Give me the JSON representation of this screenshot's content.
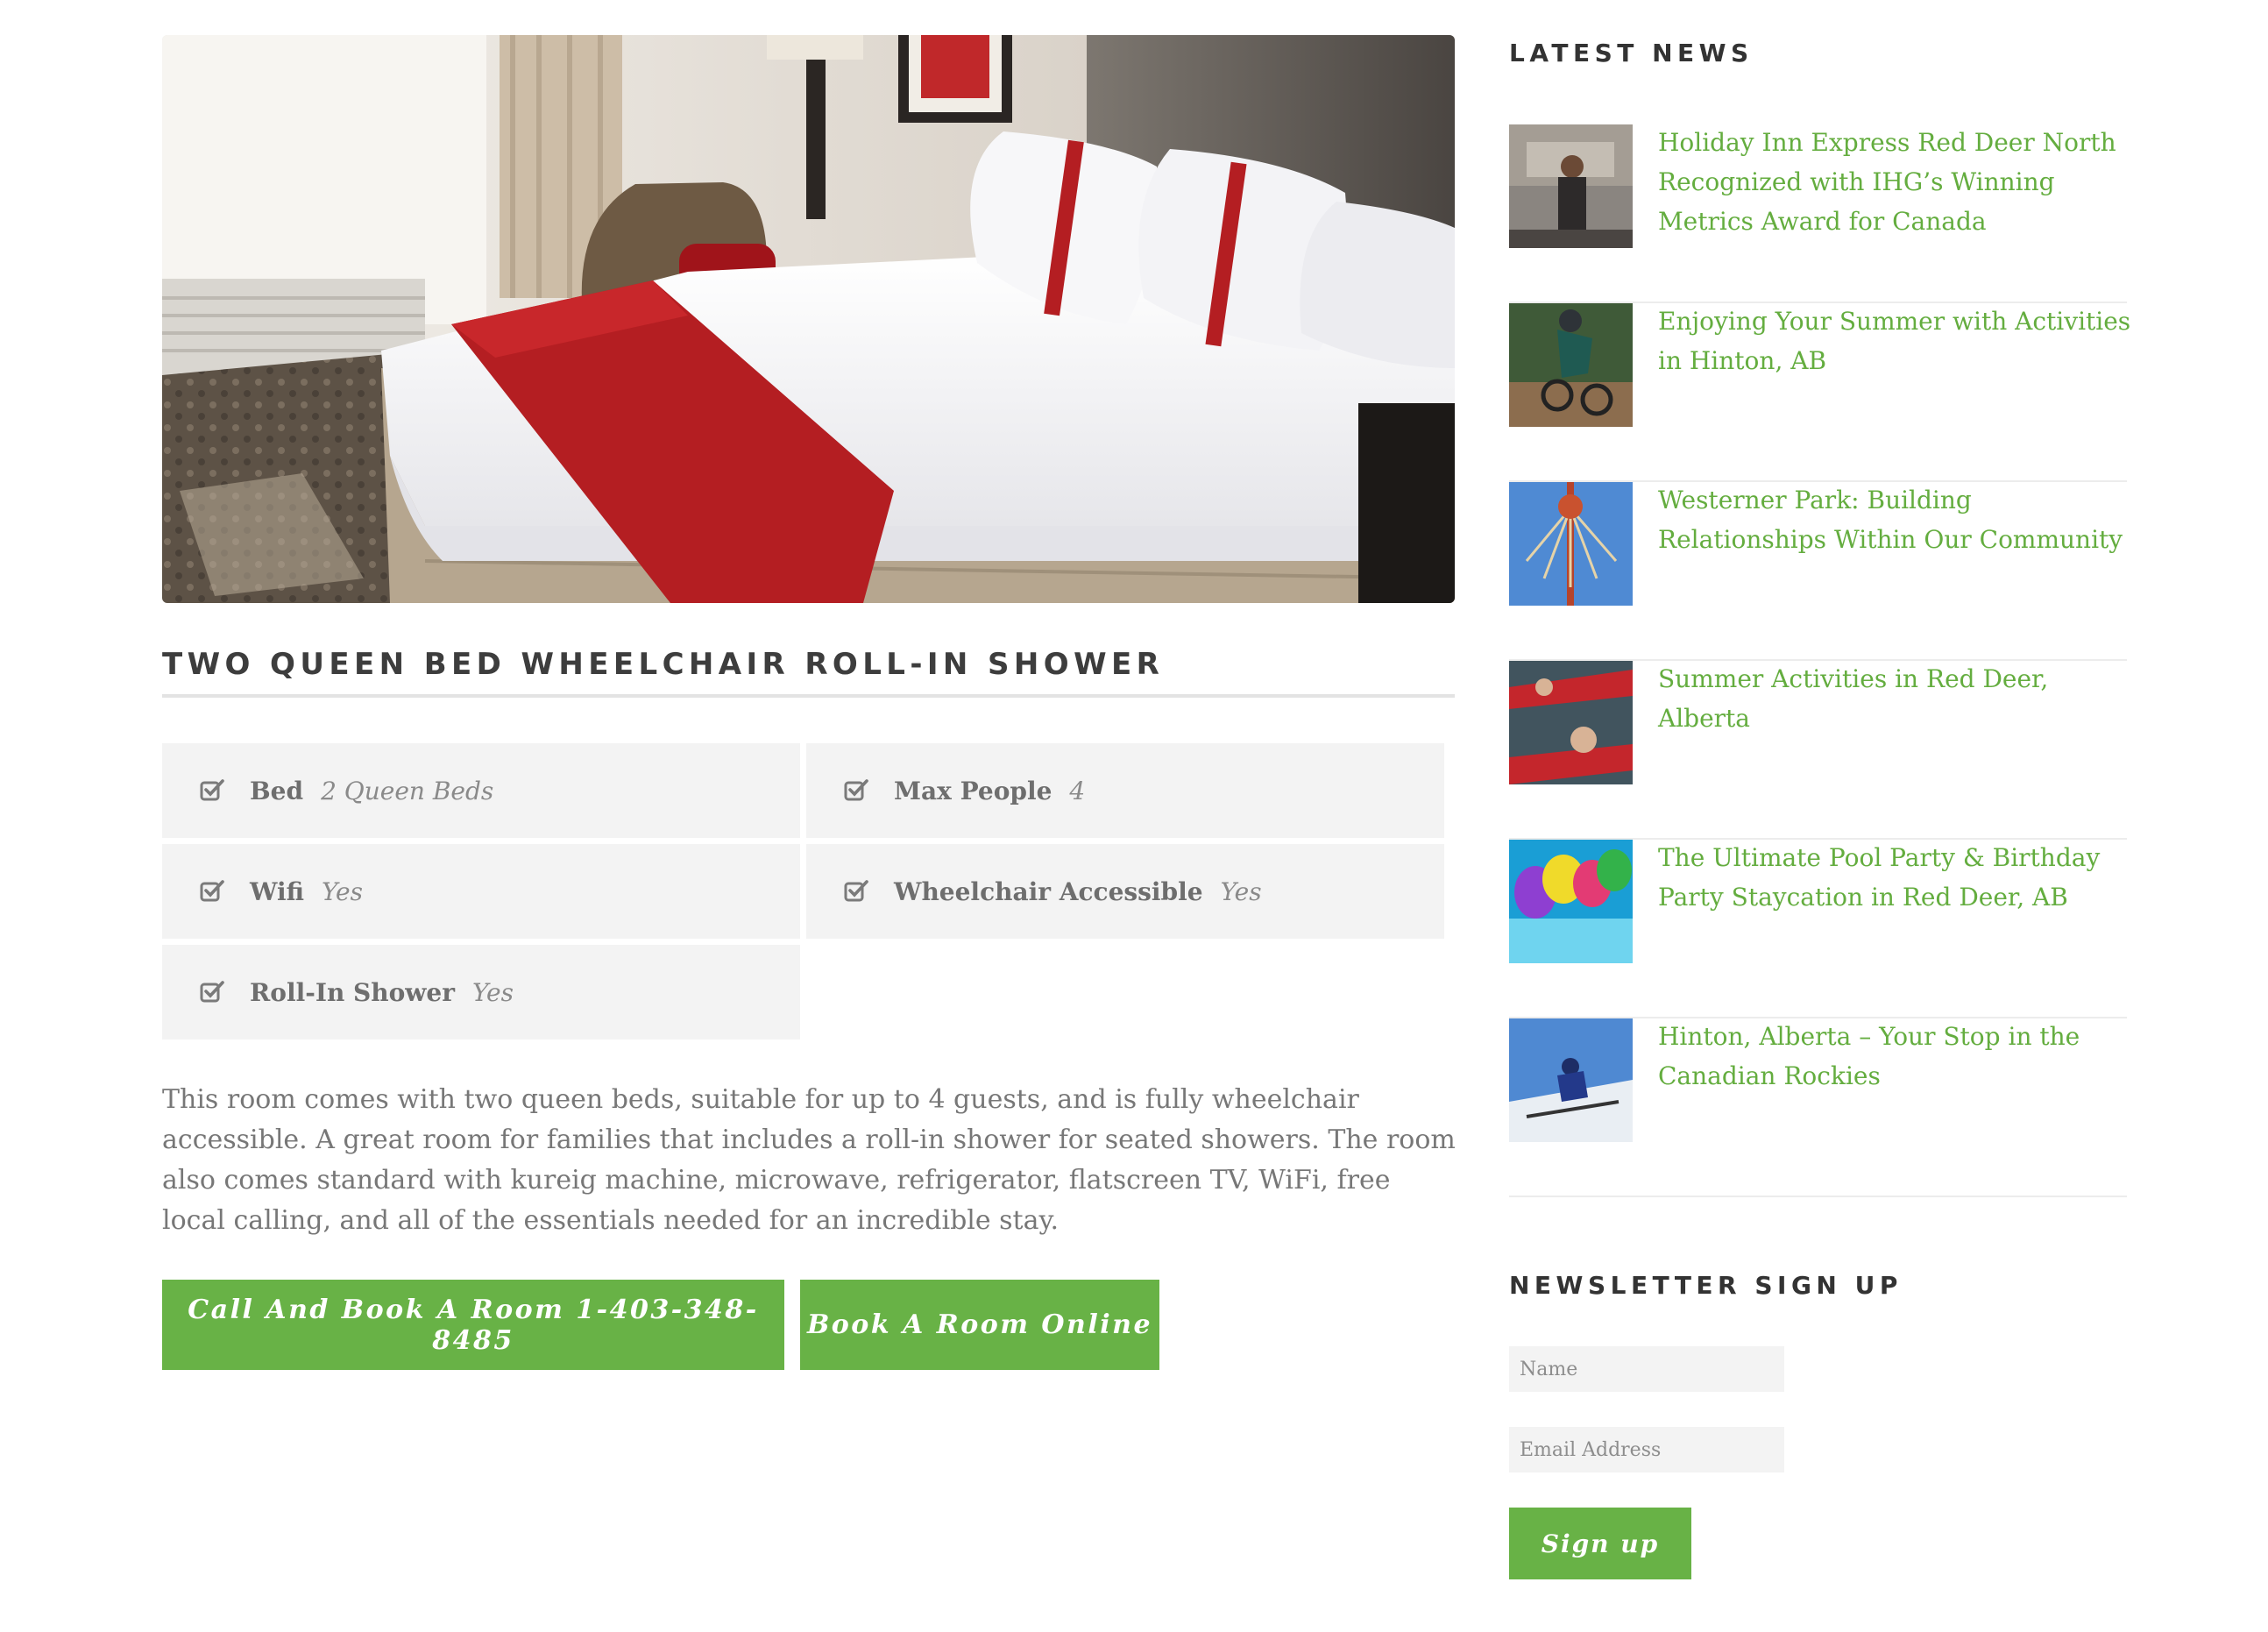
{
  "room": {
    "title": "TWO QUEEN BED WHEELCHAIR ROLL-IN SHOWER",
    "features": [
      {
        "label": "Bed",
        "value": "2 Queen Beds",
        "icon": "check-square-icon"
      },
      {
        "label": "Max People",
        "value": "4",
        "icon": "check-square-icon"
      },
      {
        "label": "Wifi",
        "value": "Yes",
        "icon": "check-square-icon"
      },
      {
        "label": "Wheelchair Accessible",
        "value": "Yes",
        "icon": "check-square-icon"
      },
      {
        "label": "Roll-In Shower",
        "value": "Yes",
        "icon": "check-square-icon"
      }
    ],
    "description": "This room comes with two queen beds, suitable for up to 4 guests, and is fully wheelchair accessible. A great room for families that includes a roll-in shower for seated showers. The room also comes standard with kureig machine, microwave, refrigerator, flatscreen TV, WiFi, free local calling, and all of the essentials needed for an incredible stay.",
    "buttons": {
      "call": "Call And Book A Room 1-403-348-8485",
      "online": "Book A Room Online"
    }
  },
  "sidebar": {
    "news_heading": "LATEST NEWS",
    "news": [
      {
        "title": "Holiday Inn Express Red Deer North Recognized with IHG’s Winning Metrics Award for Canada"
      },
      {
        "title": "Enjoying Your Summer with Activities in Hinton, AB"
      },
      {
        "title": "Westerner Park: Building Relationships Within Our Community"
      },
      {
        "title": "Summer Activities in Red Deer, Alberta"
      },
      {
        "title": "The Ultimate Pool Party & Birthday Party Staycation in Red Deer, AB"
      },
      {
        "title": "Hinton, Alberta – Your Stop in the Canadian Rockies"
      }
    ],
    "newsletter": {
      "heading": "NEWSLETTER SIGN UP",
      "name_placeholder": "Name",
      "email_placeholder": "Email Address",
      "signup_label": "Sign up"
    }
  },
  "colors": {
    "accent_green": "#68b246",
    "link_green": "#64ad3f",
    "feature_bg": "#f3f3f3",
    "bed_runner_red": "#b41e22"
  }
}
